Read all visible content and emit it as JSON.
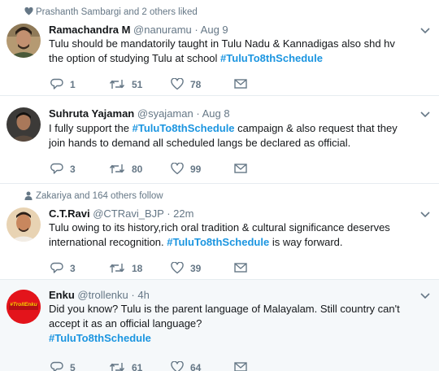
{
  "colors": {
    "accent": "#1b95e0",
    "muted": "#657786",
    "text": "#14171a",
    "divider": "#e6ecf0",
    "highlight_bg": "#f5f8fa",
    "trollenku_red": "#e3141b",
    "trollenku_text": "#ffd200"
  },
  "tweets": [
    {
      "social_context": "Prashanth Sambargi and 2 others liked",
      "social_icon": "heart-icon",
      "name": "Ramachandra M",
      "handle": "@nanuramu",
      "separator": "·",
      "time": "Aug 9",
      "text_lines": [
        "Tulu should be mandatorily taught in Tulu Nadu & Kannadigas also shd hv",
        "the option of studying Tulu at school"
      ],
      "hashtag": "#TuluTo8thSchedule",
      "replies": "1",
      "retweets": "51",
      "likes": "78"
    },
    {
      "name": "Suhruta Yajaman",
      "handle": "@syajaman",
      "separator": "·",
      "time": "Aug 8",
      "text_before": "I fully support the",
      "hashtag": "#TuluTo8thSchedule",
      "text_after": "campaign & also request that they",
      "text_line2": "join hands to demand all scheduled langs be declared as official.",
      "replies": "3",
      "retweets": "80",
      "likes": "99"
    },
    {
      "social_context": "Zakariya and 164 others follow",
      "social_icon": "person-icon",
      "name": "C.T.Ravi",
      "handle": "@CTRavi_BJP",
      "separator": "·",
      "time": "22m",
      "text_line1": "Tulu owing to its history,rich oral tradition & cultural significance deserves",
      "text_before2": "international recognition.",
      "hashtag": "#TuluTo8thSchedule",
      "text_after2": "is way forward.",
      "replies": "3",
      "retweets": "18",
      "likes": "39"
    },
    {
      "name": "Enku",
      "handle": "@trollenku",
      "separator": "·",
      "time": "4h",
      "avatar_text": "#TrollEnku",
      "text_lines": [
        "Did you know? Tulu is the parent language of Malayalam. Still country can't",
        "accept it as an official language?"
      ],
      "hashtag": "#TuluTo8thSchedule",
      "replies": "5",
      "retweets": "61",
      "likes": "64"
    }
  ]
}
